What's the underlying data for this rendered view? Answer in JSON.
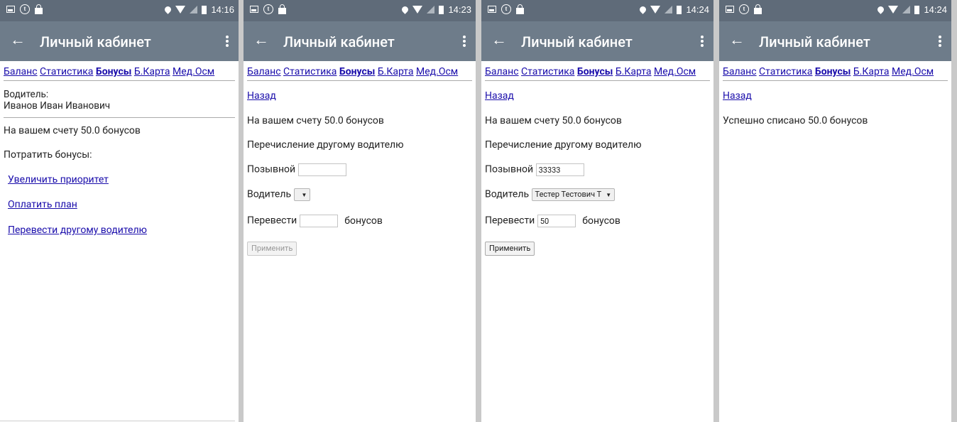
{
  "status": {
    "times": [
      "14:16",
      "14:23",
      "14:24",
      "14:24"
    ]
  },
  "toolbar": {
    "title": "Личный кабинет"
  },
  "nav": {
    "balance": "Баланс",
    "stats": "Статистика",
    "bonuses": "Бонусы",
    "card": "Б.Карта",
    "med": "Мед.Осм"
  },
  "screen1": {
    "driver_label": "Водитель:",
    "driver_name": "Иванов Иван Иванович",
    "balance_text": "На вашем счету 50.0 бонусов",
    "spend_label": "Потратить бонусы:",
    "option1": "Увеличить приоритет",
    "option2": "Оплатить план",
    "option3": "Перевести другому водителю"
  },
  "screen2": {
    "back": "Назад",
    "balance_text": "На вашем счету 50.0 бонусов",
    "transfer_title": "Перечисление другому водителю",
    "callsign_label": "Позывной",
    "callsign_value": "",
    "driver_label": "Водитель",
    "driver_value": "",
    "amount_label": "Перевести",
    "amount_value": "",
    "amount_unit": "бонусов",
    "apply": "Применить"
  },
  "screen3": {
    "back": "Назад",
    "balance_text": "На вашем счету 50.0 бонусов",
    "transfer_title": "Перечисление другому водителю",
    "callsign_label": "Позывной",
    "callsign_value": "33333",
    "driver_label": "Водитель",
    "driver_value": "Тестер Тестович Т",
    "amount_label": "Перевести",
    "amount_value": "50",
    "amount_unit": "бонусов",
    "apply": "Применить"
  },
  "screen4": {
    "back": "Назад",
    "success_text": "Успешно списано 50.0 бонусов"
  }
}
